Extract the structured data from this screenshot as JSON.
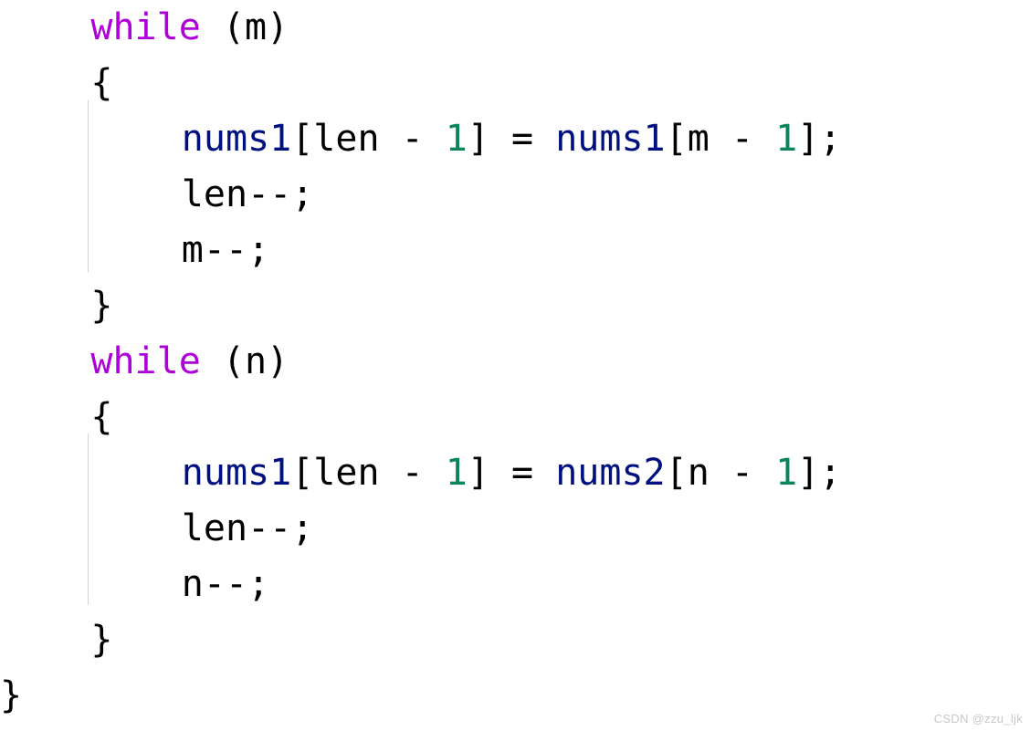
{
  "editor": {
    "background_color": "#ffffff",
    "font_size_px": 40,
    "line_height_px": 61,
    "indent_guide_color": "#d4d4d4"
  },
  "syntax_colors": {
    "keyword": "#af00db",
    "identifier": "#001080",
    "number": "#098658",
    "plain": "#000000"
  },
  "code": {
    "language": "cpp",
    "lines": [
      {
        "indent": 1,
        "text": "while (m)",
        "tokens": [
          {
            "t": "while",
            "c": "keyword"
          },
          {
            "t": " (m)",
            "c": "plain"
          }
        ]
      },
      {
        "indent": 1,
        "text": "{",
        "tokens": [
          {
            "t": "{",
            "c": "plain"
          }
        ]
      },
      {
        "indent": 2,
        "text": "nums1[len - 1] = nums1[m - 1];",
        "tokens": [
          {
            "t": "nums1",
            "c": "identifier"
          },
          {
            "t": "[len - ",
            "c": "plain"
          },
          {
            "t": "1",
            "c": "number"
          },
          {
            "t": "] = ",
            "c": "plain"
          },
          {
            "t": "nums1",
            "c": "identifier"
          },
          {
            "t": "[m - ",
            "c": "plain"
          },
          {
            "t": "1",
            "c": "number"
          },
          {
            "t": "];",
            "c": "plain"
          }
        ]
      },
      {
        "indent": 2,
        "text": "len--;",
        "tokens": [
          {
            "t": "len--;",
            "c": "plain"
          }
        ]
      },
      {
        "indent": 2,
        "text": "m--;",
        "tokens": [
          {
            "t": "m--;",
            "c": "plain"
          }
        ]
      },
      {
        "indent": 1,
        "text": "}",
        "tokens": [
          {
            "t": "}",
            "c": "plain"
          }
        ]
      },
      {
        "indent": 1,
        "text": "while (n)",
        "tokens": [
          {
            "t": "while",
            "c": "keyword"
          },
          {
            "t": " (n)",
            "c": "plain"
          }
        ]
      },
      {
        "indent": 1,
        "text": "{",
        "tokens": [
          {
            "t": "{",
            "c": "plain"
          }
        ]
      },
      {
        "indent": 2,
        "text": "nums1[len - 1] = nums2[n - 1];",
        "tokens": [
          {
            "t": "nums1",
            "c": "identifier"
          },
          {
            "t": "[len - ",
            "c": "plain"
          },
          {
            "t": "1",
            "c": "number"
          },
          {
            "t": "] = ",
            "c": "plain"
          },
          {
            "t": "nums2",
            "c": "identifier"
          },
          {
            "t": "[n - ",
            "c": "plain"
          },
          {
            "t": "1",
            "c": "number"
          },
          {
            "t": "];",
            "c": "plain"
          }
        ]
      },
      {
        "indent": 2,
        "text": "len--;",
        "tokens": [
          {
            "t": "len--;",
            "c": "plain"
          }
        ]
      },
      {
        "indent": 2,
        "text": "n--;",
        "tokens": [
          {
            "t": "n--;",
            "c": "plain"
          }
        ]
      },
      {
        "indent": 1,
        "text": "}",
        "tokens": [
          {
            "t": "}",
            "c": "plain"
          }
        ]
      },
      {
        "indent": 0,
        "text": "}",
        "tokens": [
          {
            "t": "}",
            "c": "plain"
          }
        ]
      }
    ]
  },
  "watermark": {
    "text": "CSDN @zzu_ljk",
    "color": "#c8c8c8"
  }
}
